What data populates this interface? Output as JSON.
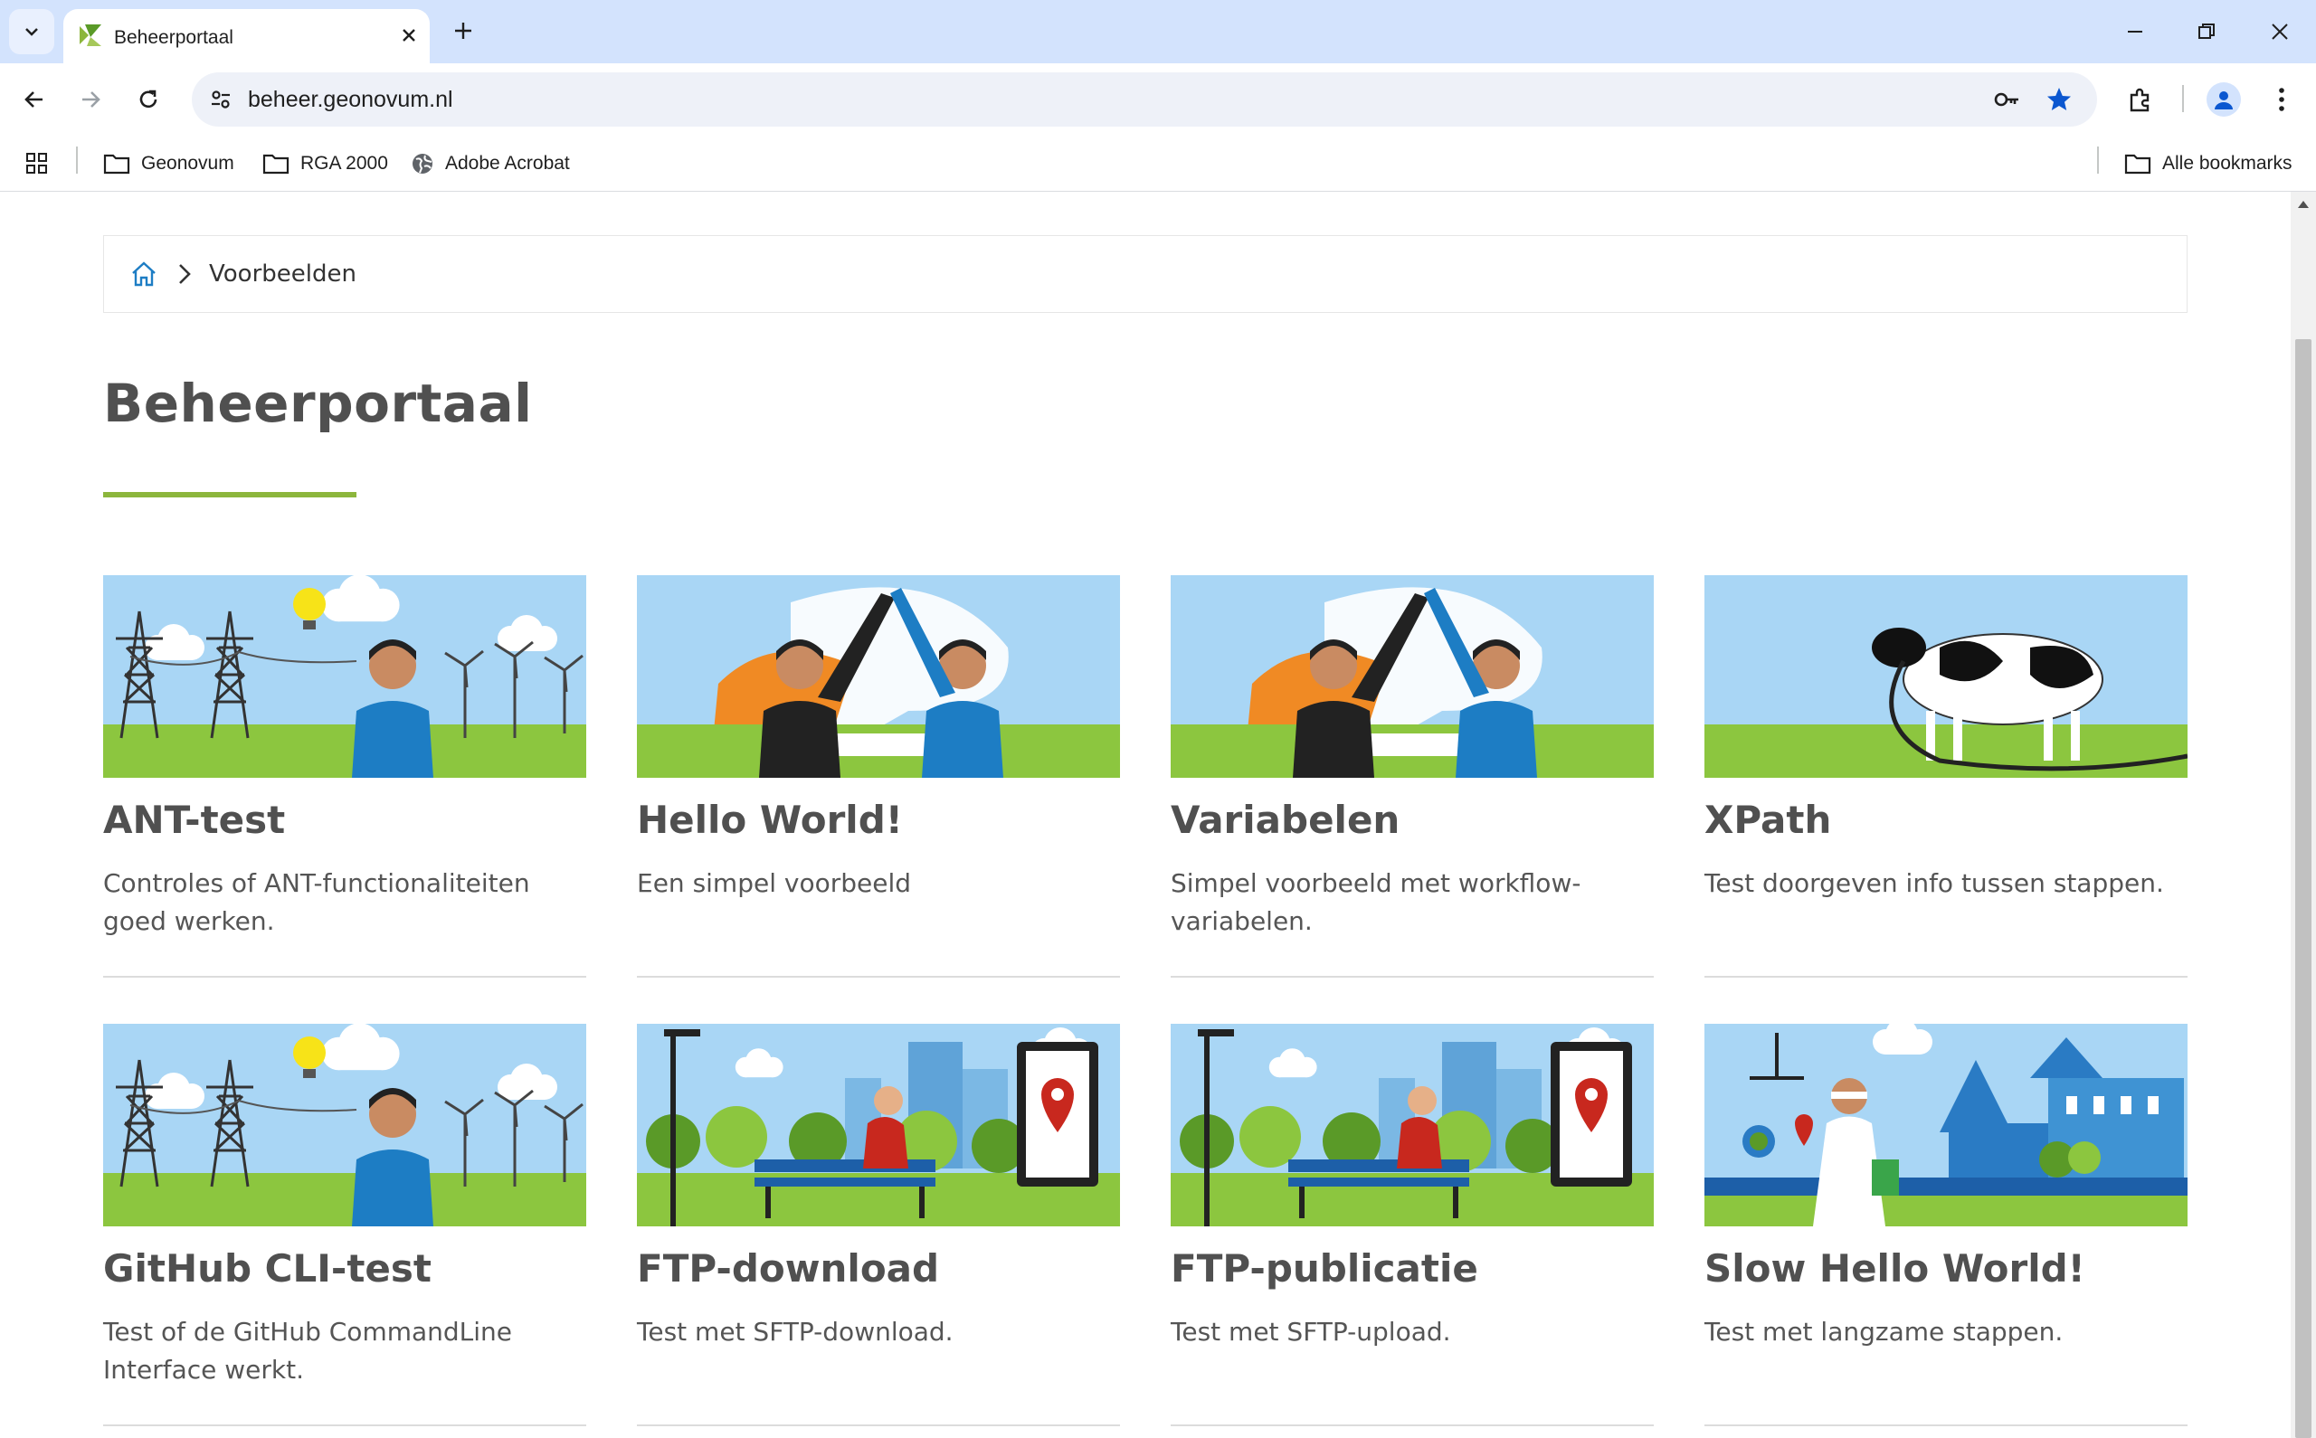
{
  "browser": {
    "tab": {
      "title": "Beheerportaal"
    },
    "url": "beheer.geonovum.nl",
    "bookmarks": [
      {
        "label": "Geonovum",
        "icon": "folder-icon"
      },
      {
        "label": "RGA 2000",
        "icon": "folder-icon"
      },
      {
        "label": "Adobe Acrobat",
        "icon": "globe-icon"
      }
    ],
    "all_bookmarks": "Alle bookmarks",
    "colors": {
      "tabbar": "#d3e3fd",
      "accent": "#1a73e8"
    }
  },
  "page": {
    "breadcrumb": {
      "current": "Voorbeelden"
    },
    "title": "Beheerportaal",
    "accent_color": "#8cb63c",
    "cards": [
      {
        "title": "ANT-test",
        "description": "Controles of ANT-functionaliteiten goed werken.",
        "illustration": "energy-idea"
      },
      {
        "title": "Hello World!",
        "description": "Een simpel voorbeeld",
        "illustration": "high-five"
      },
      {
        "title": "Variabelen",
        "description": "Simpel voorbeeld met workflow-variabelen.",
        "illustration": "high-five"
      },
      {
        "title": "XPath",
        "description": "Test doorgeven info tussen stappen.",
        "illustration": "cow"
      },
      {
        "title": "GitHub CLI-test",
        "description": "Test of de GitHub CommandLine Interface werkt.",
        "illustration": "energy-idea"
      },
      {
        "title": "FTP-download",
        "description": "Test met SFTP-download.",
        "illustration": "park-bench"
      },
      {
        "title": "FTP-publicatie",
        "description": "Test met SFTP-upload.",
        "illustration": "park-bench"
      },
      {
        "title": "Slow Hello World!",
        "description": "Test met langzame stappen.",
        "illustration": "justice"
      }
    ]
  }
}
